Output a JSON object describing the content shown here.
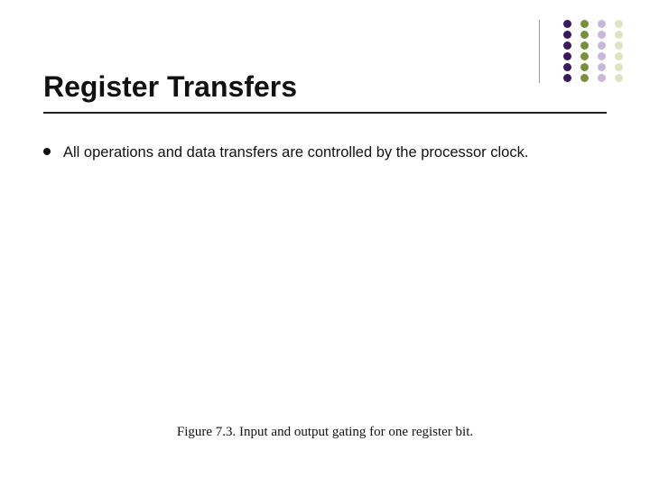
{
  "title": "Register Transfers",
  "bullets": [
    {
      "text": "All operations and data transfers are controlled by the processor clock."
    }
  ],
  "caption": "Figure 7.3.   Input and output gating for one register bit.",
  "decoration": {
    "columns": 4,
    "dots_per_column": 6,
    "colors": [
      "#3a1a5c",
      "#7a8f3c",
      "#c9b9d9",
      "#dde4c2"
    ]
  }
}
